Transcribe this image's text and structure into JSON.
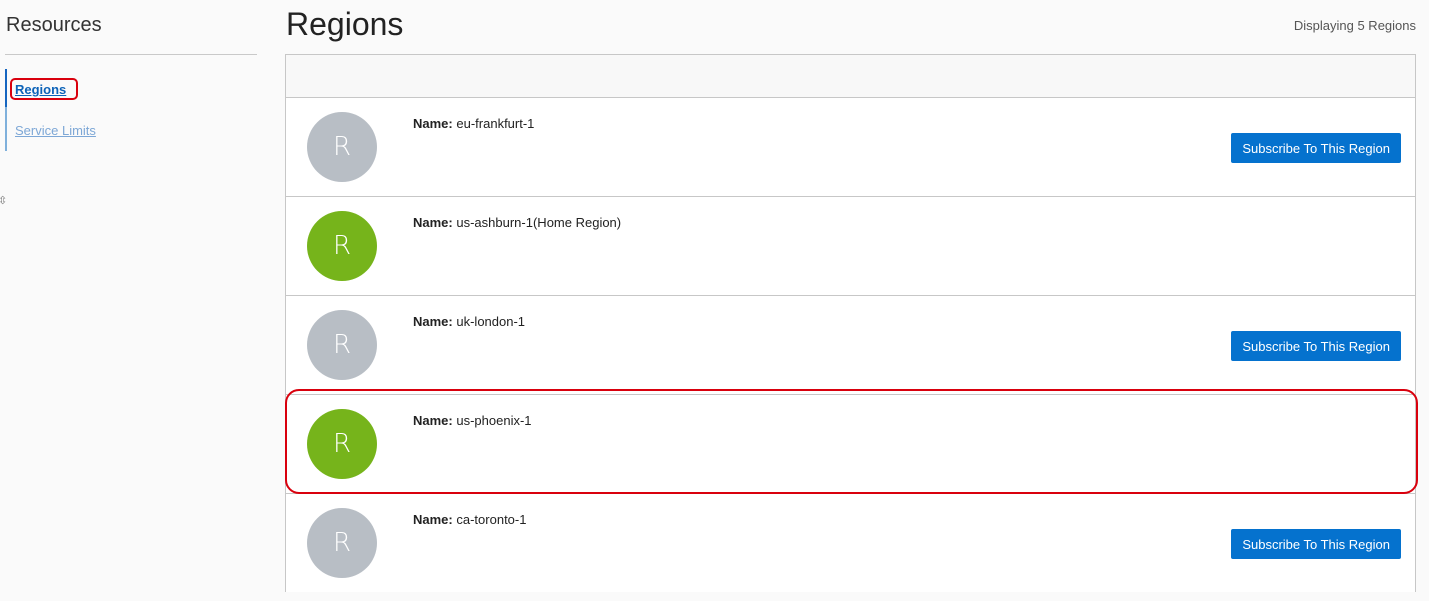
{
  "sidebar": {
    "title": "Resources",
    "items": [
      {
        "label": "Regions",
        "active": true
      },
      {
        "label": "Service Limits",
        "active": false
      }
    ]
  },
  "header": {
    "title": "Regions",
    "count_text": "Displaying 5 Regions"
  },
  "regions": {
    "name_label": "Name:",
    "subscribe_label": "Subscribe To This Region",
    "avatar_letter": "R",
    "rows": [
      {
        "name": "eu-frankfurt-1",
        "status_color": "gray",
        "subscribed": false
      },
      {
        "name": "us-ashburn-1(Home Region)",
        "status_color": "green",
        "subscribed": true
      },
      {
        "name": "uk-london-1",
        "status_color": "gray",
        "subscribed": false
      },
      {
        "name": "us-phoenix-1",
        "status_color": "green",
        "subscribed": true
      },
      {
        "name": "ca-toronto-1",
        "status_color": "gray",
        "subscribed": false
      }
    ]
  },
  "colors": {
    "accent": "#0572ce",
    "subscribed_avatar": "#76b41b",
    "unsubscribed_avatar": "#b8bec5",
    "highlight": "#d9000d"
  }
}
